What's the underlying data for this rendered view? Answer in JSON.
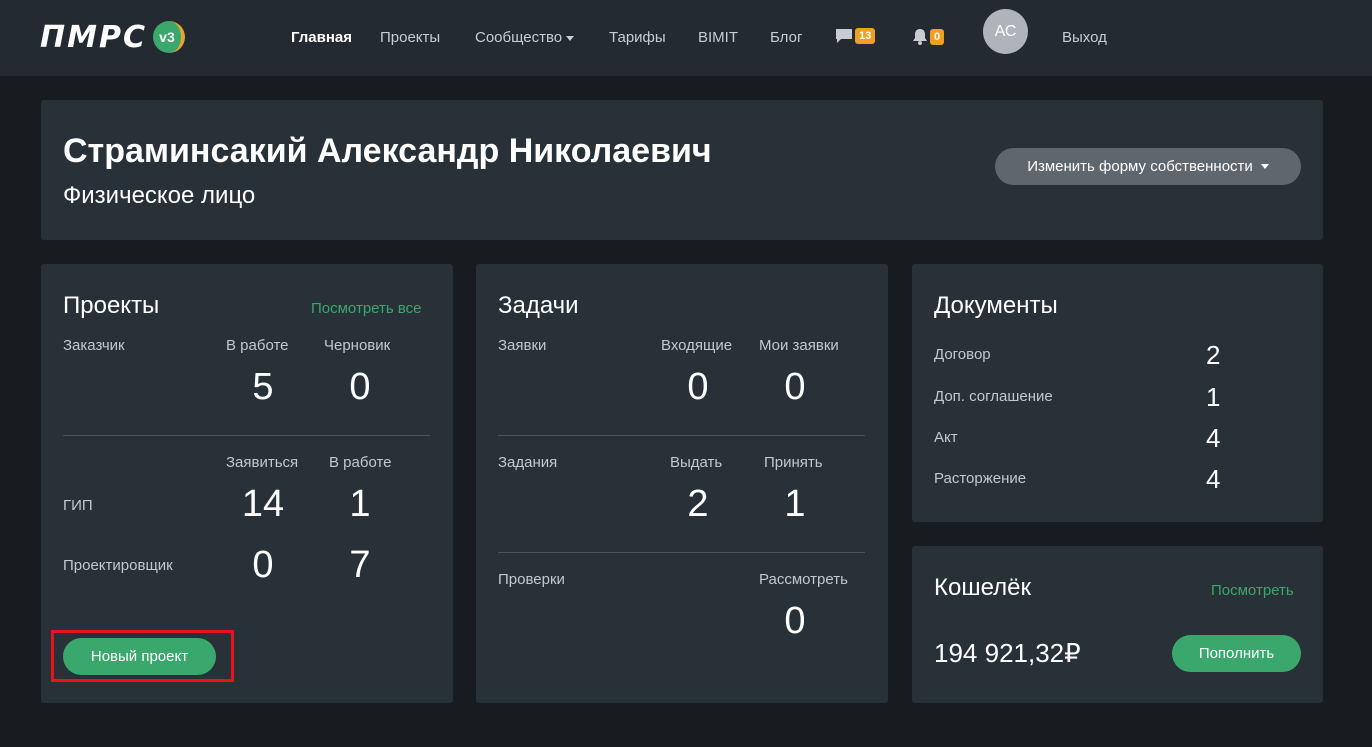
{
  "nav": {
    "logo_text": "ПМРС",
    "logo_version": "v3",
    "items": [
      "Главная",
      "Проекты",
      "Сообщество",
      "Тарифы",
      "BIMIT",
      "Блог"
    ],
    "messages_count": "13",
    "notifications_count": "0",
    "avatar_initials": "АС",
    "logout": "Выход"
  },
  "profile": {
    "name": "Страминсакий Александр Николаевич",
    "type": "Физическое лицо",
    "change_button": "Изменить форму собственности"
  },
  "projects": {
    "title": "Проекты",
    "view_all": "Посмотреть все",
    "customer_label": "Заказчик",
    "col_in_work": "В работе",
    "col_draft": "Черновик",
    "customer_in_work": "5",
    "customer_draft": "0",
    "col_apply": "Заявиться",
    "col_in_work2": "В работе",
    "gip_label": "ГИП",
    "gip_apply": "14",
    "gip_in_work": "1",
    "designer_label": "Проектировщик",
    "designer_apply": "0",
    "designer_in_work": "7",
    "new_project": "Новый проект"
  },
  "tasks": {
    "title": "Задачи",
    "requests_label": "Заявки",
    "col_incoming": "Входящие",
    "col_my_requests": "Мои заявки",
    "incoming": "0",
    "my_requests": "0",
    "assignments_label": "Задания",
    "col_issue": "Выдать",
    "col_accept": "Принять",
    "issue": "2",
    "accept": "1",
    "checks_label": "Проверки",
    "col_review": "Рассмотреть",
    "review": "0"
  },
  "documents": {
    "title": "Документы",
    "items": [
      {
        "label": "Договор",
        "value": "2"
      },
      {
        "label": "Доп. соглашение",
        "value": "1"
      },
      {
        "label": "Акт",
        "value": "4"
      },
      {
        "label": "Расторжение",
        "value": "4"
      }
    ]
  },
  "wallet": {
    "title": "Кошелёк",
    "view": "Посмотреть",
    "amount": "194 921,32₽",
    "top_up": "Пополнить"
  },
  "colors": {
    "accent": "#3aa76d",
    "badge": "#f0a020",
    "highlight": "#e8131c",
    "card": "#283038",
    "background": "#181c20"
  }
}
